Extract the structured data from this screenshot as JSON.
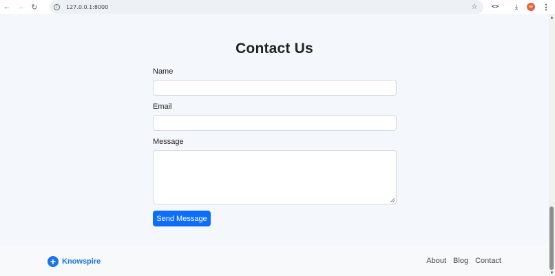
{
  "browser": {
    "url": "127.0.0.1:8000",
    "back_glyph": "←",
    "forward_glyph": "→",
    "reload_glyph": "↻",
    "info_glyph": "i",
    "star_glyph": "☆",
    "code_glyph": "<>",
    "download_glyph": "⤓",
    "menu_glyph": "⋮"
  },
  "scrollbar": {
    "up_glyph": "▲",
    "down_glyph": "▼"
  },
  "contact": {
    "title": "Contact Us",
    "name_label": "Name",
    "name_value": "",
    "email_label": "Email",
    "email_value": "",
    "message_label": "Message",
    "message_value": "",
    "send_label": "Send Message"
  },
  "footer": {
    "brand_icon_glyph": "+",
    "brand_name": "Knowspire",
    "links": [
      "About",
      "Blog",
      "Contact"
    ]
  },
  "colors": {
    "accent": "#0d6efd",
    "brand": "#1a73e8",
    "page_background": "#f4f7fb"
  }
}
